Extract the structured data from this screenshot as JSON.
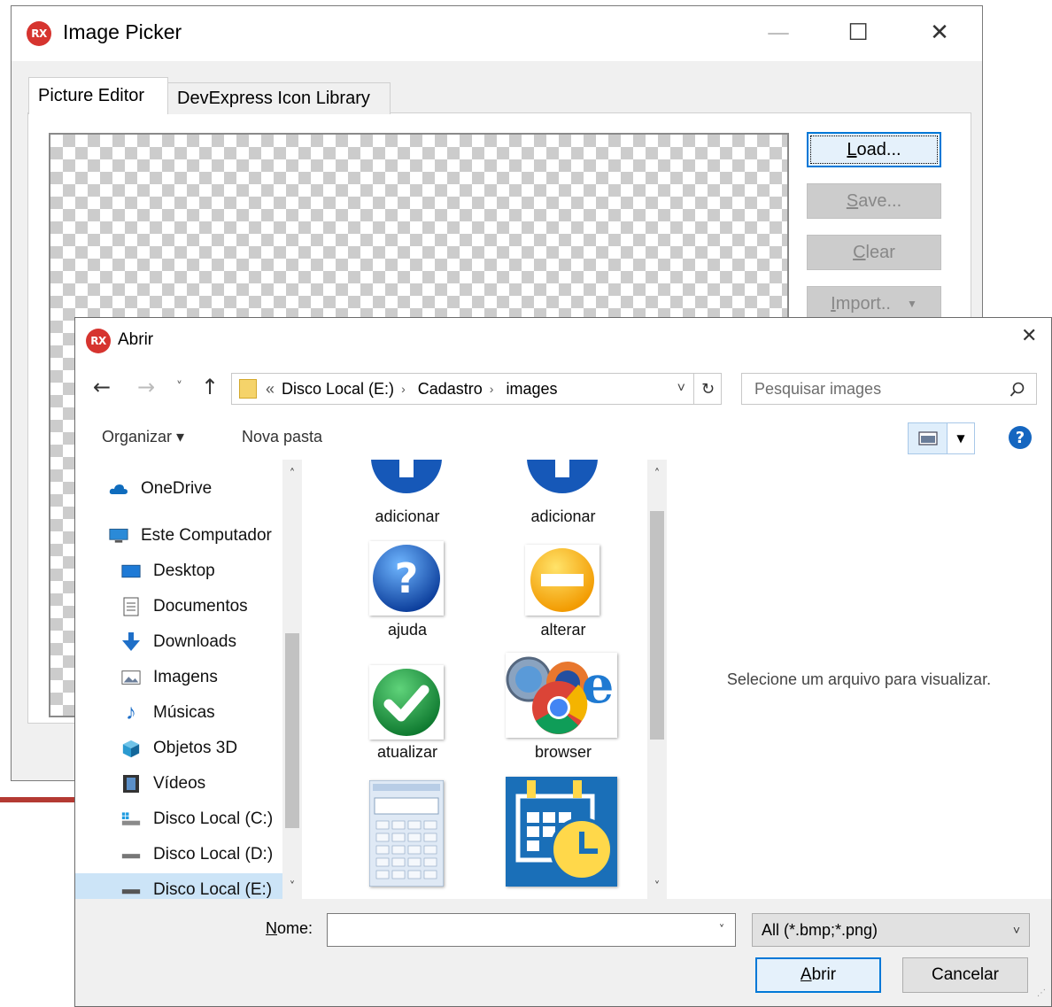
{
  "picker": {
    "logo": "RX",
    "title": "Image Picker",
    "tabs": [
      {
        "label": "Picture Editor"
      },
      {
        "label": "DevExpress Icon Library"
      }
    ],
    "buttons": {
      "load": {
        "mn": "L",
        "rest": "oad..."
      },
      "save": {
        "mn": "S",
        "rest": "ave..."
      },
      "clear": {
        "mn": "C",
        "rest": "lear"
      },
      "import": {
        "mn": "I",
        "rest": "mport.."
      }
    },
    "window_controls": {
      "minimize": "—",
      "maximize": "☐",
      "close": "✕"
    }
  },
  "abrir": {
    "logo": "RX",
    "title": "Abrir",
    "close": "✕",
    "nav": {
      "back": "←",
      "forward": "→",
      "recent": "˅",
      "up": "↑"
    },
    "address": {
      "prefix": "«",
      "crumbs": [
        "Disco Local (E:)",
        "Cadastro",
        "images"
      ],
      "separator": "›",
      "dropdown": "˅",
      "refresh": "↻"
    },
    "search": {
      "placeholder": "Pesquisar images",
      "icon": "search-icon"
    },
    "toolbar": {
      "organize": "Organizar ▾",
      "new_folder": "Nova pasta",
      "help": "?"
    },
    "nav_items": [
      {
        "label": "OneDrive",
        "icon": "cloud-icon"
      },
      {
        "label": "Este Computador",
        "icon": "computer-icon"
      },
      {
        "label": "Desktop",
        "icon": "desktop-icon"
      },
      {
        "label": "Documentos",
        "icon": "document-icon"
      },
      {
        "label": "Downloads",
        "icon": "download-icon"
      },
      {
        "label": "Imagens",
        "icon": "pictures-icon"
      },
      {
        "label": "Músicas",
        "icon": "music-icon"
      },
      {
        "label": "Objetos 3D",
        "icon": "cube-icon"
      },
      {
        "label": "Vídeos",
        "icon": "video-icon"
      },
      {
        "label": "Disco Local (C:)",
        "icon": "windows-drive-icon"
      },
      {
        "label": "Disco Local (D:)",
        "icon": "drive-icon"
      },
      {
        "label": "Disco Local (E:)",
        "icon": "drive-icon",
        "selected": true
      }
    ],
    "files": [
      {
        "name": "adicionar",
        "icon": "plus-circle-icon"
      },
      {
        "name": "adicionar",
        "icon": "plus-circle-icon"
      },
      {
        "name": "ajuda",
        "icon": "question-circle-icon"
      },
      {
        "name": "alterar",
        "icon": "minus-circle-icon"
      },
      {
        "name": "atualizar",
        "icon": "check-circle-icon"
      },
      {
        "name": "browser",
        "icon": "browsers-icon"
      },
      {
        "name": "",
        "icon": "calculator-icon"
      },
      {
        "name": "",
        "icon": "calendar-clock-icon"
      }
    ],
    "preview_text": "Selecione um arquivo para visualizar.",
    "name_label": {
      "mn": "N",
      "rest": "ome:"
    },
    "name_value": "",
    "filter": "All (*.bmp;*.png)",
    "buttons": {
      "open": {
        "mn": "A",
        "rest": "brir"
      },
      "cancel": "Cancelar"
    }
  },
  "colors": {
    "accent": "#0078d7",
    "rx_red": "#d6342f",
    "selection": "#cce4f7"
  }
}
